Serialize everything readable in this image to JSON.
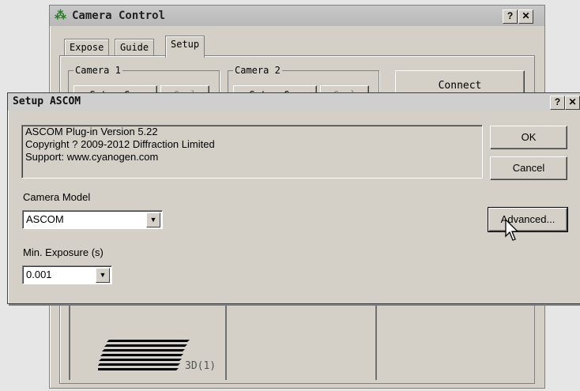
{
  "camera_control": {
    "title": "Camera Control",
    "help_label": "?",
    "close_label": "✕",
    "tabs": [
      "Expose",
      "Guide",
      "Setup"
    ],
    "active_tab": "Setup",
    "camera1_caption": "Camera 1",
    "camera2_caption": "Camera 2",
    "camera1_buttons": [
      "Setup Cam",
      "Cool"
    ],
    "camera2_buttons": [
      "Setup Cam",
      "Cool"
    ],
    "connect_label": "Connect",
    "preview_label": "3D(1)"
  },
  "dialog": {
    "title": "Setup ASCOM",
    "help_label": "?",
    "close_label": "✕",
    "info_lines": [
      "ASCOM Plug-in Version 5.22",
      "Copyright ? 2009-2012 Diffraction Limited",
      "Support: www.cyanogen.com"
    ],
    "camera_model_label": "Camera Model",
    "camera_model_value": "ASCOM",
    "min_exposure_label": "Min. Exposure (s)",
    "min_exposure_value": "0.001",
    "ok_label": "OK",
    "cancel_label": "Cancel",
    "advanced_label": "Advanced..."
  },
  "icons": {
    "app_icon": "camera-app-icon",
    "dropdown_icon": "chevron-down-icon",
    "cursor_icon": "mouse-pointer-icon"
  }
}
